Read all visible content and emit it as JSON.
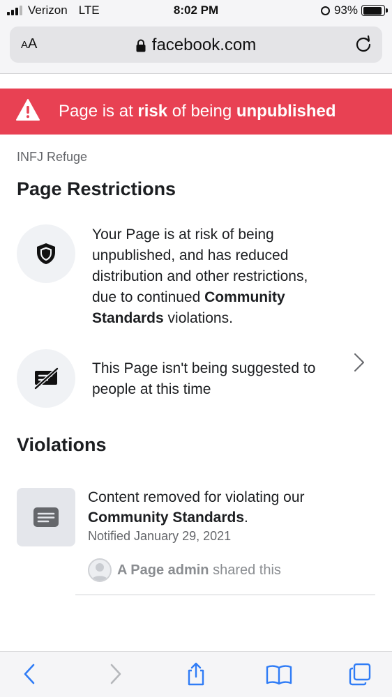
{
  "status_bar": {
    "carrier": "Verizon",
    "network": "LTE",
    "time": "8:02 PM",
    "battery": "93%",
    "battery_level": 0.93
  },
  "browser": {
    "text_size_small": "A",
    "text_size_large": "A",
    "url": "facebook.com"
  },
  "banner": {
    "pre": "Page is at ",
    "bold1": "risk",
    "mid": " of being ",
    "bold2": "unpublished",
    "color": "#e84153"
  },
  "page_name": "INFJ Refuge",
  "restrictions": {
    "heading": "Page Restrictions",
    "items": [
      {
        "icon": "shield-icon",
        "lines": [
          "Your Page is at risk of being",
          "unpublished, and has reduced",
          "distribution and other restrictions,",
          "due to continued "
        ],
        "bold": "Community",
        "bold2": "Standards",
        "tail": " violations."
      },
      {
        "icon": "crossed-out-message-icon",
        "line1": "This Page isn't being suggested to",
        "line2": "people at this time"
      }
    ]
  },
  "violations": {
    "heading": "Violations",
    "item": {
      "icon": "message-icon",
      "line1": "Content removed for violating our",
      "bold": "Community Standards",
      "suffix": ".",
      "date": "Notified January 29, 2021"
    },
    "admin": {
      "bold": "A Page admin",
      "rest": " shared this"
    }
  },
  "colors": {
    "link_blue": "#2f7cf6",
    "muted_gray": "#65676b"
  }
}
